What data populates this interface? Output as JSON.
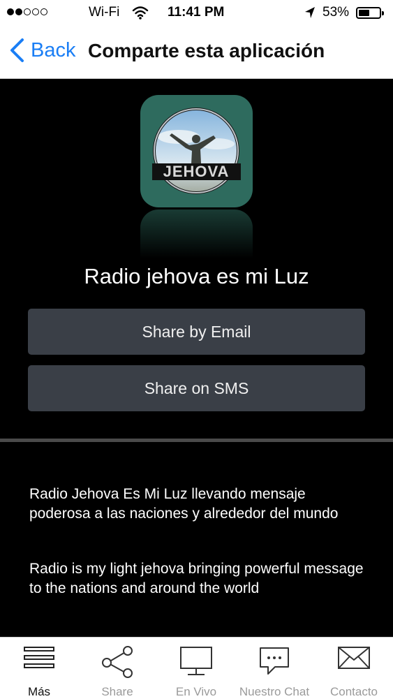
{
  "status_bar": {
    "carrier": "Wi-Fi",
    "time": "11:41 PM",
    "battery_percent": "53%",
    "battery_level": 0.53,
    "signal_bars_filled": 2,
    "signal_bars_total": 5
  },
  "nav": {
    "back_label": "Back",
    "title": "Comparte esta aplicación"
  },
  "app": {
    "name": "Radio jehova es mi Luz",
    "icon_text": "JEHOVA"
  },
  "buttons": {
    "email": "Share by Email",
    "sms": "Share on SMS"
  },
  "description": {
    "spanish": "Radio Jehova Es Mi Luz llevando mensaje poderosa a las naciones y alrededor del mundo",
    "english": "Radio is my light jehova bringing powerful message to the nations and around the world"
  },
  "tabs": [
    {
      "label": "Más",
      "icon": "menu-icon",
      "active": true
    },
    {
      "label": "Share",
      "icon": "share-icon",
      "active": false
    },
    {
      "label": "En Vivo",
      "icon": "monitor-icon",
      "active": false
    },
    {
      "label": "Nuestro Chat",
      "icon": "chat-icon",
      "active": false
    },
    {
      "label": "Contacto",
      "icon": "mail-icon",
      "active": false
    }
  ],
  "colors": {
    "accent": "#1a7ef5",
    "background": "#000000",
    "button": "#3a3f47",
    "icon_bg": "#2e6b5e"
  }
}
